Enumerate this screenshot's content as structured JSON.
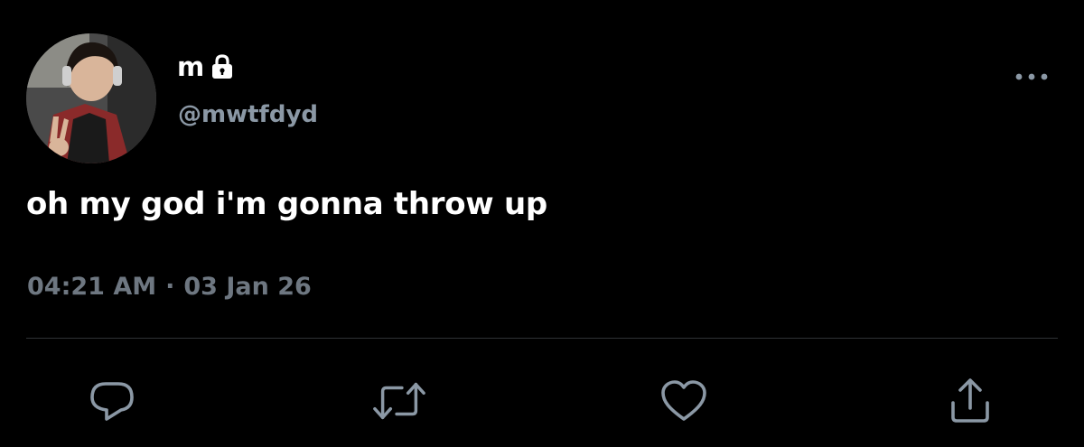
{
  "tweet": {
    "display_name": "m",
    "handle": "@mwtfdyd",
    "text": "oh my god i'm gonna throw up",
    "time": "04:21 AM",
    "separator": "·",
    "date": "03 Jan 26"
  },
  "icons": {
    "lock": "lock-icon",
    "more": "more-options-icon",
    "reply": "reply-icon",
    "retweet": "retweet-icon",
    "like": "heart-icon",
    "share": "share-icon"
  },
  "colors": {
    "background": "#000000",
    "primary_text": "#ffffff",
    "secondary_text": "#8b98a5",
    "icon": "#8b98a5",
    "divider": "#2f3336"
  }
}
